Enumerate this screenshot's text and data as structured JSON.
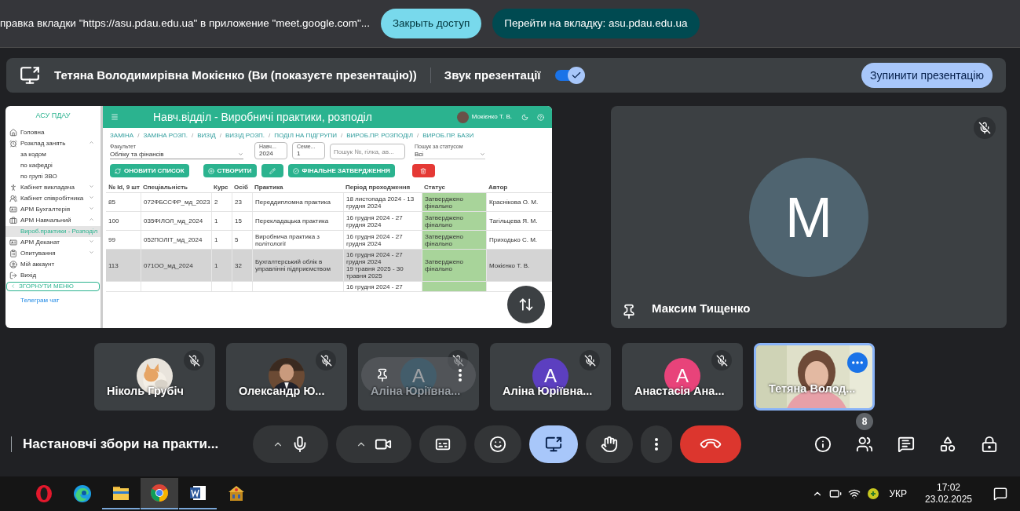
{
  "share_banner": {
    "text": "правка вкладки \"https://asu.pdau.edu.ua\" в приложение \"meet.google.com\"...",
    "buttons": [
      {
        "label": "Закрыть доступ",
        "kind": "secondary"
      },
      {
        "label": "Перейти на вкладку: asu.pdau.edu.ua",
        "kind": "primary"
      }
    ]
  },
  "presenting_bar": {
    "title": "Тетяна Володимирівна Мокієнко (Ви (показуєте презентацію))",
    "audio_label": "Звук презентації",
    "audio_on": true,
    "stop_button": "Зупинити презентацію"
  },
  "presentation": {
    "sidebar": {
      "title": "АСУ ПДАУ",
      "items": [
        {
          "label": "Головна",
          "selected": false
        },
        {
          "label": "Розклад занять",
          "expanded": true,
          "selected": false,
          "children": [
            {
              "label": "за кодом",
              "selected": false
            },
            {
              "label": "по кафедрі",
              "selected": false
            },
            {
              "label": "по групі ЗВО",
              "selected": false
            }
          ]
        },
        {
          "label": "Кабінет викладача",
          "expanded": false,
          "selected": false
        },
        {
          "label": "Кабінет співробітника",
          "expanded": false,
          "selected": false
        },
        {
          "label": "АРМ Бухгалтерія",
          "expanded": false,
          "selected": false
        },
        {
          "label": "АРМ Навчальний",
          "expanded": true,
          "selected": false,
          "children": [
            {
              "label": "Вироб.практики - Розподіл",
              "selected": true
            }
          ]
        },
        {
          "label": "АРМ Деканат",
          "expanded": false,
          "selected": false
        },
        {
          "label": "Опитування",
          "expanded": false,
          "selected": false
        },
        {
          "label": "Мій аккаунт",
          "selected": false
        },
        {
          "label": "Вихід",
          "selected": false
        }
      ],
      "collapse_button": "ЗГОРНУТИ МЕНЮ",
      "footer_link": "Телеграм чат"
    },
    "header": {
      "title": "Навч.відділ - Виробничі практики, розподіл",
      "user": "Мокієнко Т. В."
    },
    "breadcrumb_separator": "/",
    "breadcrumbs": [
      "ЗАМІНА",
      "ЗАМІНА РОЗП.",
      "ВИЗІД",
      "ВИЗІД РОЗП.",
      "ПОДІЛ НА ПІДГРУПИ",
      "ВИРОБ.ПР. РОЗПОДІЛ",
      "ВИРОБ.ПР. БАЗИ"
    ],
    "filters": {
      "faculty": {
        "label": "Факультет",
        "value": "Обліку та фінансів"
      },
      "year": {
        "label": "Навч...",
        "value": "2024"
      },
      "semester": {
        "label": "Семе...",
        "value": "1"
      },
      "search": {
        "placeholder": "Пошук №, гілка, ав..."
      },
      "status": {
        "label": "Пошук за статусом",
        "value": "Всі"
      }
    },
    "actions": [
      {
        "kind": "refresh",
        "label": "ОНОВИТИ СПИСОК"
      },
      {
        "kind": "create",
        "label": "СТВОРИТИ"
      },
      {
        "kind": "edit"
      },
      {
        "kind": "finalize",
        "label": "ФІНАЛЬНЕ ЗАТВЕРДЖЕННЯ"
      },
      {
        "kind": "delete"
      }
    ],
    "table": {
      "columns": [
        "№ Id, 9 шт",
        "Спеціальність",
        "Курс",
        "Осіб",
        "Практика",
        "Період проходження",
        "Статус",
        "Автор"
      ],
      "rows": [
        {
          "selected": false,
          "cells": [
            "85",
            "072ФБССФР_мд_2023",
            "2",
            "23",
            "Переддипломна практика",
            [
              "18 листопада 2024 - 13 грудня 2024"
            ],
            "Затверджено фінально",
            "Краснікова О. М."
          ]
        },
        {
          "selected": false,
          "cells": [
            "100",
            "035ФІЛОЛ_мд_2024",
            "1",
            "15",
            "Перекладацька практика",
            [
              "16 грудня 2024 - 27 грудня 2024"
            ],
            "Затверджено фінально",
            "Тагільцева Я. М."
          ]
        },
        {
          "selected": false,
          "cells": [
            "99",
            "052ПОЛІТ_мд_2024",
            "1",
            "5",
            "Виробнича практика з політології",
            [
              "16 грудня 2024 - 27 грудня 2024"
            ],
            "Затверджено фінально",
            "Приходько С. М."
          ]
        },
        {
          "selected": true,
          "cells": [
            "113",
            "071ОО_мд_2024",
            "1",
            "32",
            "Бухгалтерський облік в управлінні підприємством",
            [
              "16 грудня 2024 - 27 грудня 2024",
              "19 травня 2025 - 30 травня 2025"
            ],
            "Затверджено фінально",
            "Мокієнко Т. В."
          ]
        },
        {
          "selected": false,
          "cells": [
            "",
            "",
            "",
            "",
            "",
            [
              "16 грудня 2024 - 27"
            ],
            "",
            ""
          ]
        }
      ]
    }
  },
  "spotlight": {
    "initial": "М",
    "color": "#4f6470",
    "name": "Максим Тищенко",
    "muted": true,
    "pinned": true
  },
  "tiles": [
    {
      "name": "Ніколь Грубіч",
      "muted": true,
      "selected": false
    },
    {
      "name": "Олександр Ю...",
      "muted": true,
      "selected": false
    },
    {
      "kind": "hovered",
      "initial": "А",
      "color": "#1b5670",
      "name": "Аліна Юріївна...",
      "muted": true,
      "selected": false
    },
    {
      "kind": "letter",
      "initial": "А",
      "color": "#5c3fc0",
      "name": "Аліна Юріївна...",
      "muted": true,
      "selected": false
    },
    {
      "kind": "letter",
      "initial": "А",
      "color": "#e8437a",
      "name": "Анастасія Ана...",
      "muted": true,
      "selected": false
    },
    {
      "kind": "video",
      "name": "Тетяна Волод...",
      "muted": false,
      "selected": true
    }
  ],
  "meeting_title": "Настановчі збори на практи...",
  "controls": [
    {
      "kind": "mic",
      "has_menu": true,
      "active": false
    },
    {
      "kind": "camera",
      "has_menu": true,
      "active": false
    },
    {
      "kind": "captions",
      "has_menu": false,
      "active": false
    },
    {
      "kind": "emoji",
      "has_menu": false,
      "active": false
    },
    {
      "kind": "present",
      "has_menu": false,
      "active": true
    },
    {
      "kind": "hand",
      "has_menu": false,
      "active": false
    },
    {
      "kind": "more",
      "has_menu": false,
      "active": false
    },
    {
      "kind": "leave",
      "has_menu": false,
      "active": false
    }
  ],
  "side_controls": [
    {
      "kind": "info"
    },
    {
      "kind": "people",
      "badge": "8"
    },
    {
      "kind": "chat"
    },
    {
      "kind": "activities"
    },
    {
      "kind": "host"
    }
  ],
  "taskbar": {
    "apps": [
      {
        "kind": "opera",
        "running": false,
        "active": false
      },
      {
        "kind": "edge",
        "running": false,
        "active": false
      },
      {
        "kind": "folder",
        "running": true,
        "active": false
      },
      {
        "kind": "chrome",
        "running": true,
        "active": true
      },
      {
        "kind": "word",
        "running": true,
        "active": false
      },
      {
        "kind": "app",
        "running": false,
        "active": false
      }
    ],
    "language": "УКР",
    "time": "17:02",
    "date": "23.02.2025"
  }
}
